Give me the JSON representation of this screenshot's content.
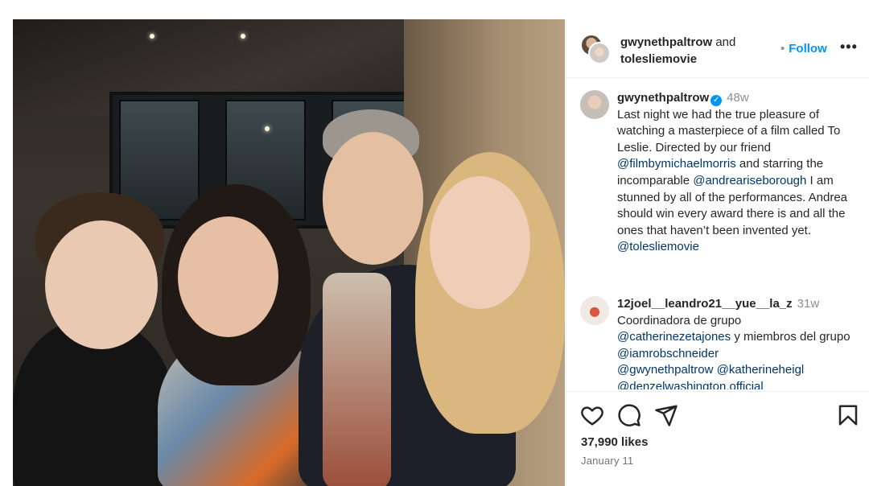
{
  "header": {
    "user1": "gwynethpaltrow",
    "and": "and",
    "user2": "tolesliemovie",
    "follow": "Follow"
  },
  "caption": {
    "user": "gwynethpaltrow",
    "time": "48w",
    "text_1": "Last night we had the true pleasure of watching a masterpiece of a film called To Leslie. Directed by our friend ",
    "mention_1": "@filmbymichaelmorris",
    "text_2": " and starring the incomparable ",
    "mention_2": "@andreariseborough",
    "text_3": " I am stunned by all of the performances. Andrea should win every award there is and all the ones that haven’t been invented yet.",
    "mention_3": "@tolesliemovie"
  },
  "comment": {
    "user": "12joel__leandro21__yue__la_z",
    "time": "31w",
    "text_1": "Coordinadora de grupo ",
    "mention_1": "@catherinezetajones",
    "text_2": " y miembros del grupo ",
    "mention_2": "@iamrobschneider",
    "mention_3": "@gwynethpaltrow",
    "mention_4": "@katherineheigl",
    "mention_5": "@denzelwashington.official"
  },
  "footer": {
    "likes": "37,990 likes",
    "date": "January 11"
  },
  "icons": [
    "heart-icon",
    "comment-icon",
    "share-icon",
    "bookmark-icon",
    "more-icon",
    "verified-icon"
  ],
  "colors": {
    "follow": "#0095f6",
    "mention": "#00376b",
    "muted": "#8e8e8e",
    "text": "#262626"
  }
}
